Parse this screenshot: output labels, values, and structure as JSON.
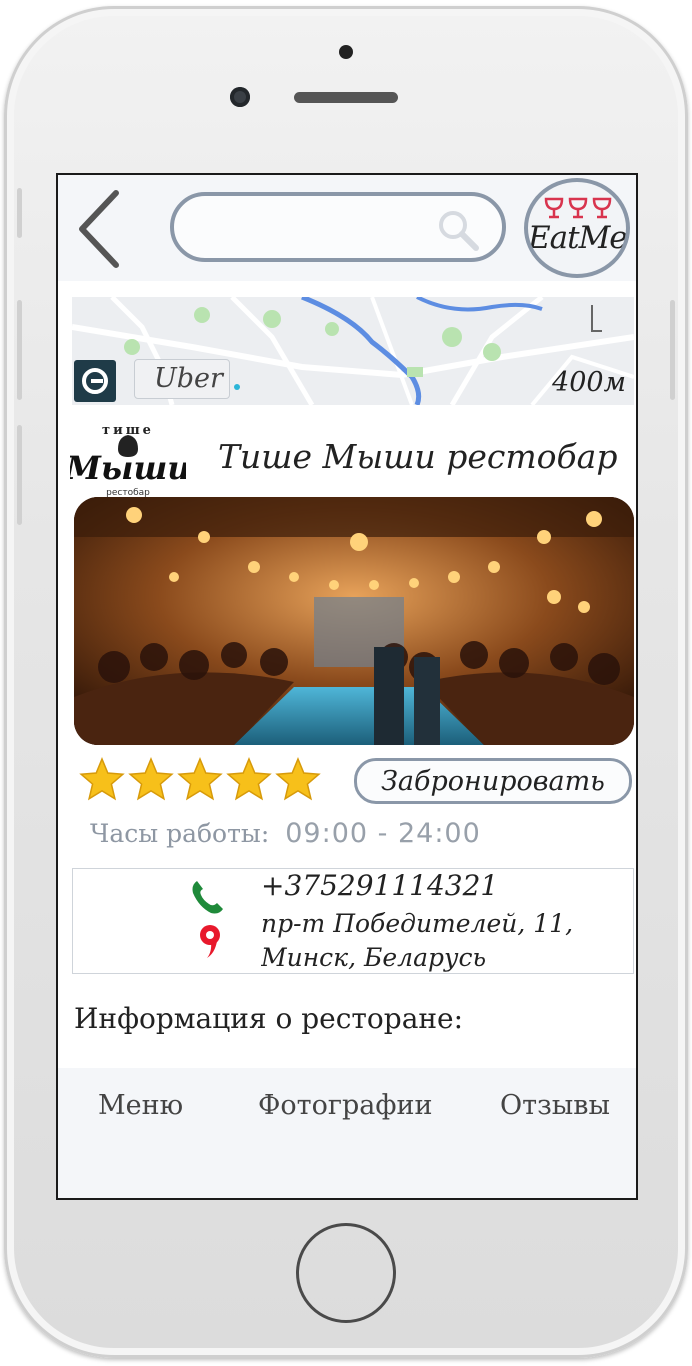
{
  "header": {
    "search_placeholder": "",
    "brand_logo_text": "EatMe"
  },
  "map": {
    "taxi_label": "Uber",
    "distance": "400м"
  },
  "restaurant": {
    "logo_text_top": "тише",
    "logo_text_main": "Мыши",
    "logo_text_bottom": "рестобар",
    "name": "Тише Мыши рестобар",
    "rating": 5,
    "rating_max": 5,
    "book_label": "Забронировать",
    "hours_label": "Часы работы:",
    "hours_value": "09:00 - 24:00",
    "phone": "+375291114321",
    "address": "пр-т Победителей, 11, Минск, Беларусь",
    "info_title": "Информация о ресторане:"
  },
  "tabs": [
    {
      "label": "Меню"
    },
    {
      "label": "Фотографии"
    },
    {
      "label": "Отзывы"
    }
  ],
  "colors": {
    "accent_border": "#8a97a8",
    "bar_background": "#f4f6f9",
    "star": "#f7c01a",
    "phone_icon": "#1f8a3a",
    "pin_icon": "#e8192c",
    "logo_glasses": "#d8344e"
  },
  "icons": {
    "back": "chevron-left-icon",
    "search": "magnifier-icon",
    "uber": "uber-icon",
    "phone": "phone-icon",
    "location": "map-pin-icon",
    "star": "star-icon"
  }
}
